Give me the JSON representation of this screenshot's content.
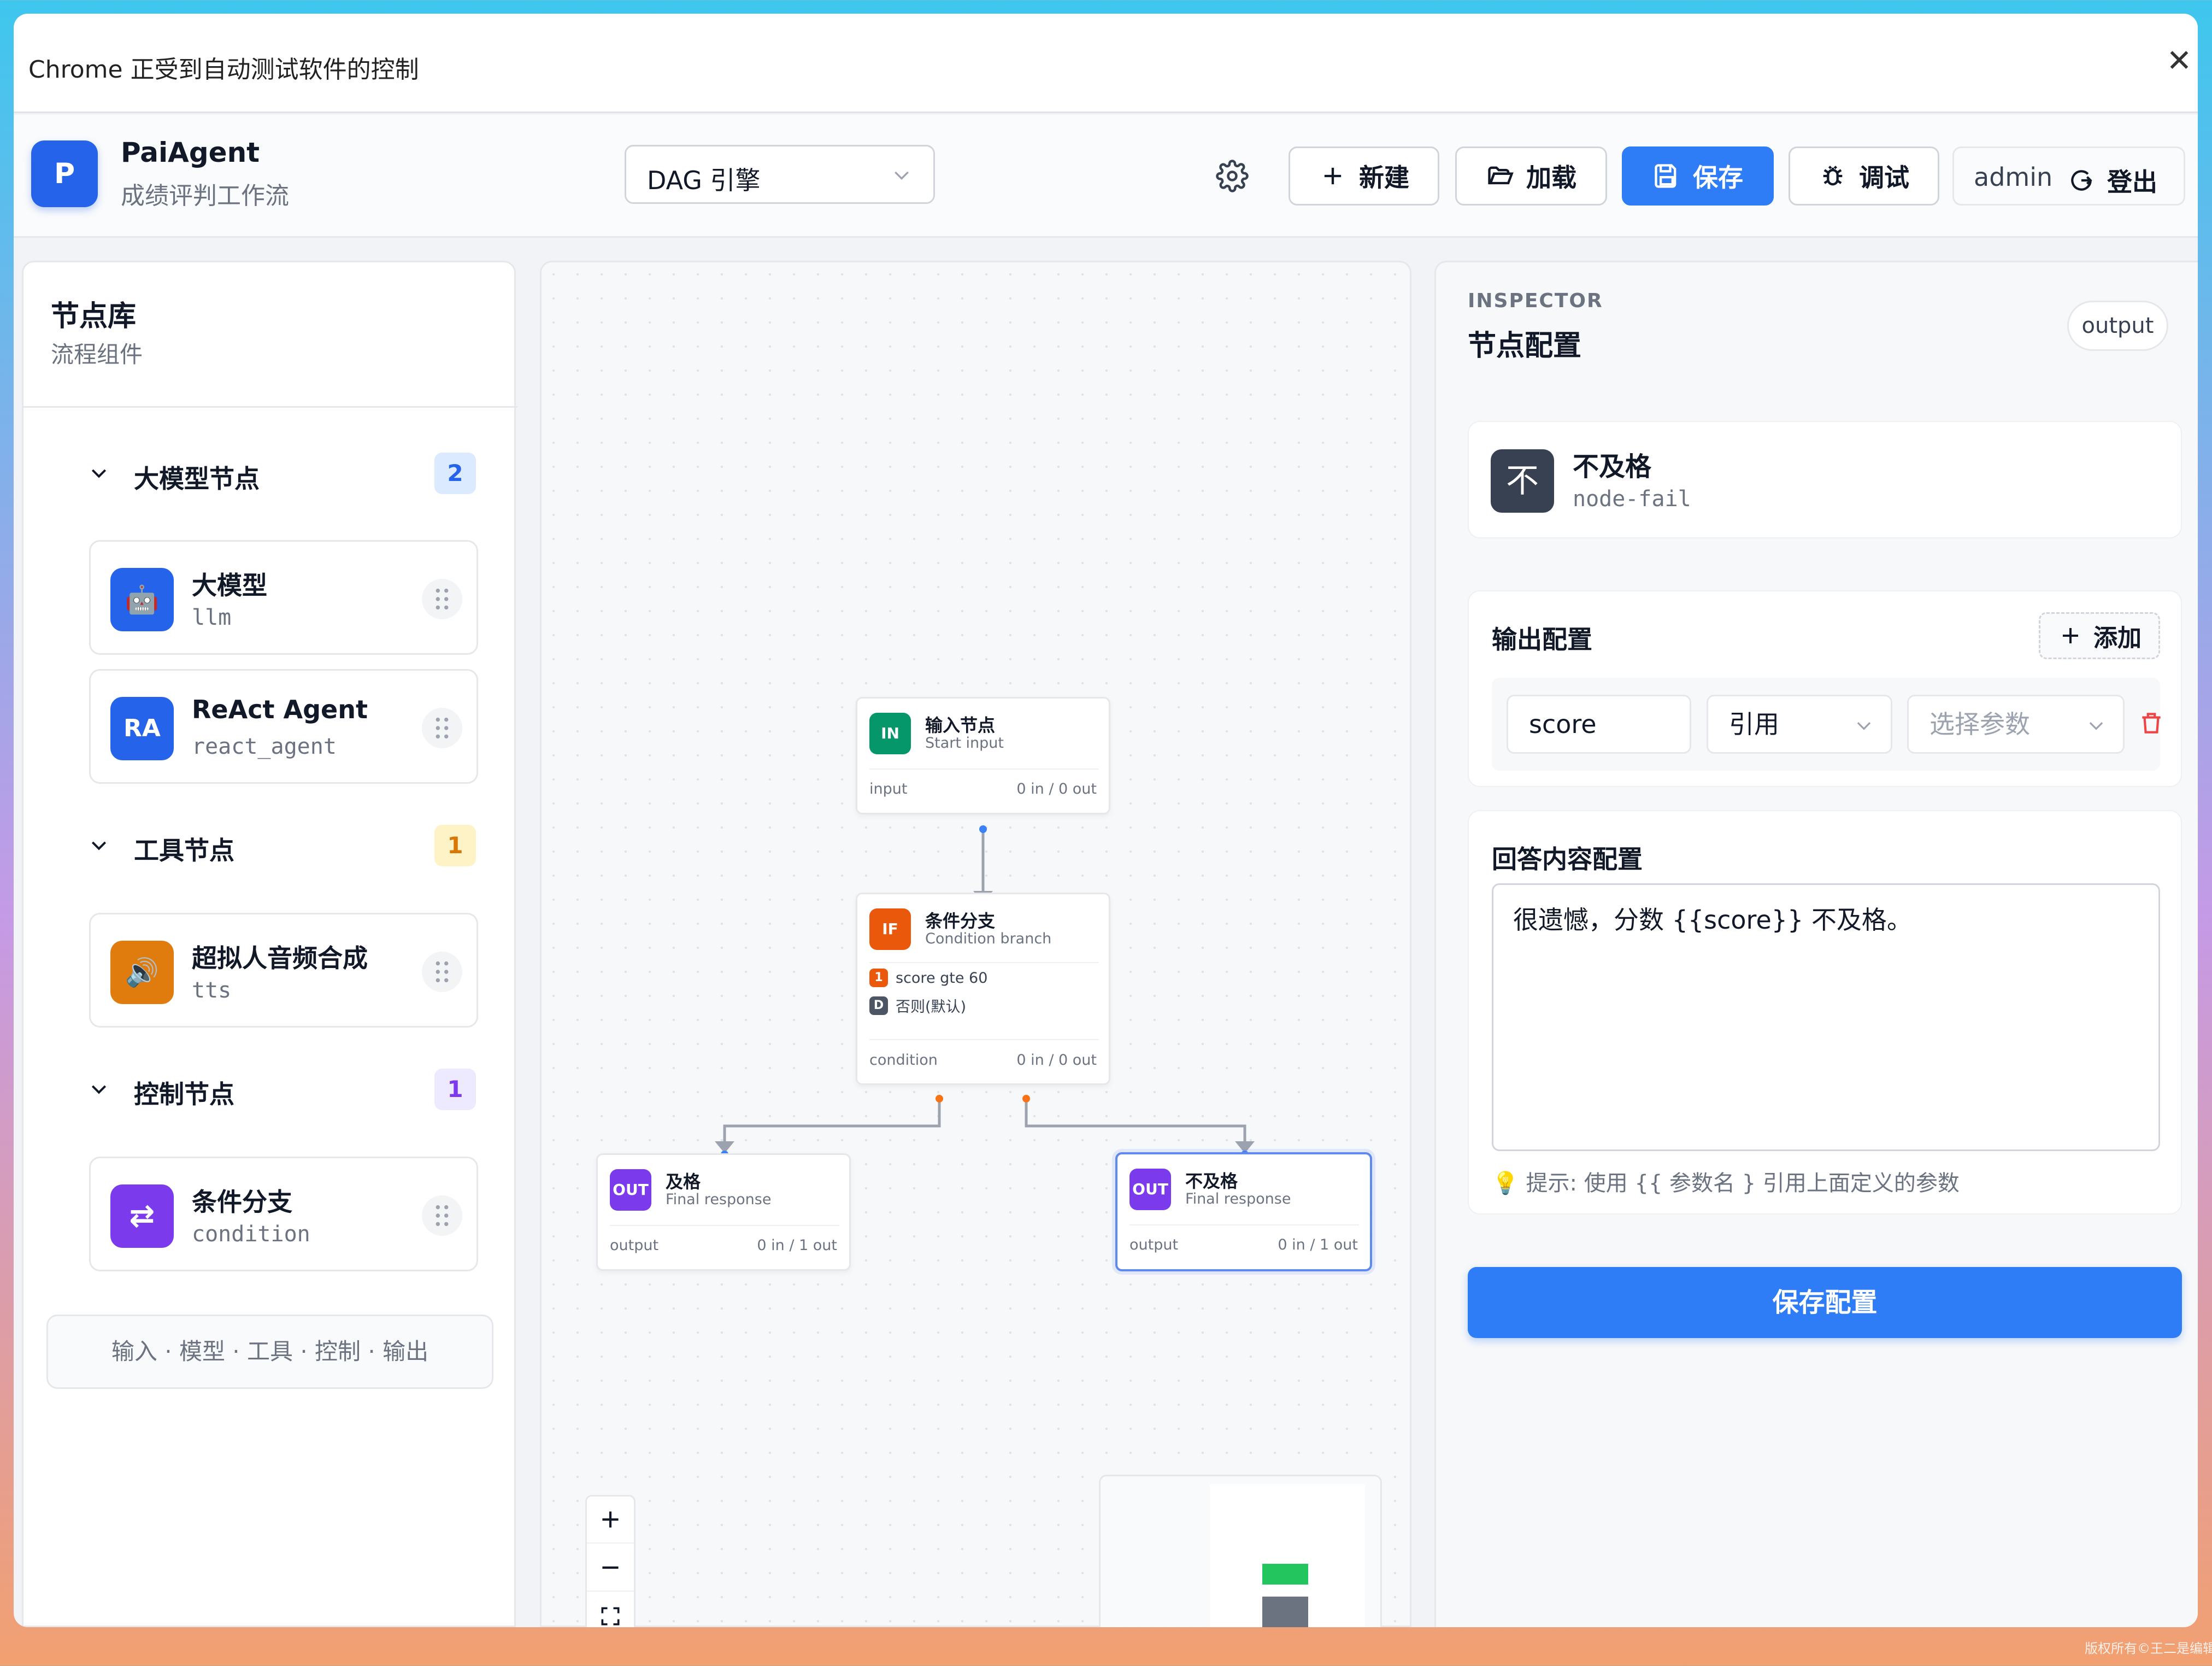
{
  "chrome_bar": {
    "message": "Chrome 正受到自动测试软件的控制",
    "close": "✕"
  },
  "header": {
    "logo_letter": "P",
    "app_name": "PaiAgent",
    "app_subtitle": "成绩评判工作流",
    "engine_select": "DAG 引擎",
    "buttons": {
      "new": "新建",
      "load": "加载",
      "save": "保存",
      "debug": "调试"
    },
    "user": "admin",
    "logout": "登出"
  },
  "left_panel": {
    "title": "节点库",
    "subtitle": "流程组件",
    "groups": [
      {
        "name": "大模型节点",
        "count": "2",
        "color": "#2563eb",
        "nodes": [
          {
            "name": "大模型",
            "code": "llm",
            "icon_text": "🤖",
            "color": "#2563eb"
          },
          {
            "name": "ReAct Agent",
            "code": "react_agent",
            "icon_text": "RA",
            "color": "#2563eb"
          }
        ]
      },
      {
        "name": "工具节点",
        "count": "1",
        "color": "#d97706",
        "nodes": [
          {
            "name": "超拟人音频合成",
            "code": "tts",
            "icon_text": "🔊",
            "color": "#e07b0e"
          }
        ]
      },
      {
        "name": "控制节点",
        "count": "1",
        "color": "#7c3aed",
        "nodes": [
          {
            "name": "条件分支",
            "code": "condition",
            "icon_text": "⇄",
            "color": "#7c3aed"
          }
        ]
      }
    ],
    "footer": "输入 · 模型 · 工具 · 控制 · 输出"
  },
  "canvas": {
    "nodes": [
      {
        "id": "input",
        "icon": "IN",
        "title": "输入节点",
        "subtitle": "Start input",
        "type": "input",
        "io": "0 in / 0 out",
        "color": "#059669"
      },
      {
        "id": "condition",
        "icon": "IF",
        "title": "条件分支",
        "subtitle": "Condition branch",
        "type": "condition",
        "io": "0 in / 0 out",
        "color": "#ea580c",
        "conditions": [
          {
            "key": "1",
            "text": "score gte 60"
          },
          {
            "key": "D",
            "text": "否则(默认)"
          }
        ]
      },
      {
        "id": "pass",
        "icon": "OUT",
        "title": "及格",
        "subtitle": "Final response",
        "type": "output",
        "io": "0 in / 1 out",
        "color": "#7c3aed"
      },
      {
        "id": "fail",
        "icon": "OUT",
        "title": "不及格",
        "subtitle": "Final response",
        "type": "output",
        "io": "0 in / 1 out",
        "color": "#7c3aed"
      }
    ],
    "zoom_controls": [
      "+",
      "−",
      "⛶"
    ]
  },
  "inspector": {
    "kicker": "INSPECTOR",
    "title": "节点配置",
    "tag": "output",
    "node": {
      "badge": "不",
      "name": "不及格",
      "id": "node-fail"
    },
    "output_config": {
      "title": "输出配置",
      "add": "添加",
      "param_name": "score",
      "ref_type": "引用",
      "param_placeholder": "选择参数"
    },
    "answer_config": {
      "title": "回答内容配置",
      "content": "很遗憾，分数 {{score}} 不及格。",
      "hint": "💡 提示: 使用 {{ 参数名 } 引用上面定义的参数"
    },
    "save_button": "保存配置"
  },
  "watermark": "版权所有©王二是编辑"
}
